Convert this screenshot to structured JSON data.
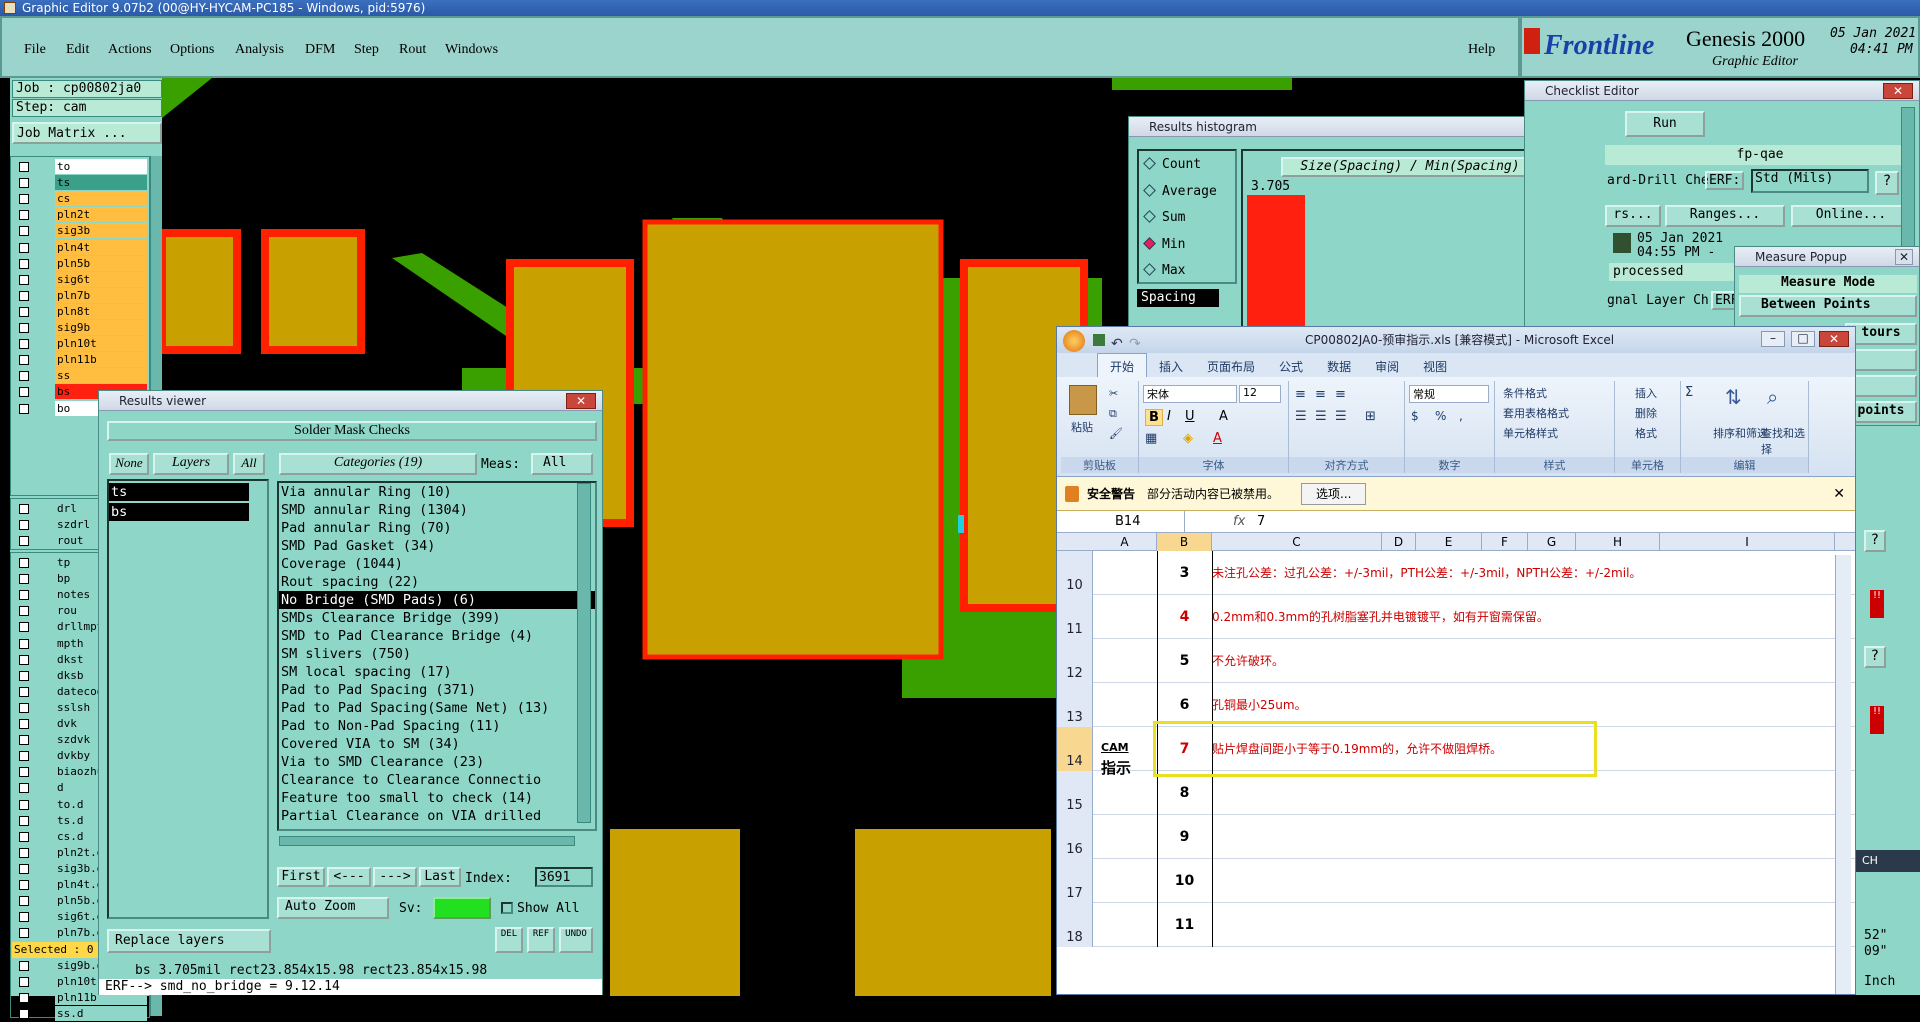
{
  "titlebar": {
    "text": "Graphic Editor 9.07b2 (00@HY-HYCAM-PC185 - Windows, pid:5976)"
  },
  "menu": {
    "items": [
      "File",
      "Edit",
      "Actions",
      "Options",
      "Analysis",
      "DFM",
      "Step",
      "Rout",
      "Windows"
    ],
    "help": "Help"
  },
  "brand": {
    "logo": "Frontline",
    "product": "Genesis 2000",
    "subtitle": "Graphic Editor",
    "date": "05 Jan 2021",
    "time": "04:41 PM"
  },
  "left": {
    "job": "Job : cp00802ja0",
    "step": "Step: cam",
    "job_matrix": "Job Matrix ...",
    "layers": [
      "to",
      "ts",
      "cs",
      "pln2t",
      "sig3b",
      "pln4t",
      "pln5b",
      "sig6t",
      "pln7b",
      "pln8t",
      "sig9b",
      "pln10t",
      "pln11b",
      "ss",
      "bs",
      "bo"
    ],
    "layers2": [
      "drl",
      "szdrl",
      "rout"
    ],
    "layers3": [
      "tp",
      "bp",
      "notes",
      "rou",
      "drllmpt",
      "mpth",
      "dkst",
      "dksb",
      "datecode",
      "sslsh",
      "dvk",
      "szdvk",
      "dvkby",
      "biaozhu",
      "d",
      "to.d",
      "ts.d",
      "cs.d",
      "pln2t.d",
      "sig3b.d",
      "pln4t.d",
      "pln5b.d",
      "sig6t.d",
      "pln7b.d",
      "pln8t.d",
      "sig9b.d",
      "pln10t",
      "pln11b",
      "ss.d"
    ],
    "selected": "Selected : 0"
  },
  "results_viewer": {
    "title": "Results viewer",
    "header": "Solder Mask Checks",
    "none": "None",
    "layers": "Layers",
    "all": "All",
    "categories": "Categories (19)",
    "meas_label": "Meas:",
    "meas_value": "All",
    "layer_list": [
      "ts",
      "bs"
    ],
    "checks": [
      "Via annular Ring (10)",
      "SMD annular Ring (1304)",
      "Pad annular Ring (70)",
      "SMD Pad Gasket (34)",
      "Coverage (1044)",
      "Rout spacing (22)",
      "No Bridge (SMD Pads) (6)",
      "SMDs Clearance Bridge (399)",
      "SMD to Pad Clearance Bridge (4)",
      "SM slivers (750)",
      "SM local spacing (17)",
      "Pad to Pad Spacing (371)",
      "Pad to Pad Spacing(Same Net) (13)",
      "Pad to Non-Pad Spacing (11)",
      "Covered VIA to SM (34)",
      "Via to SMD Clearance (23)",
      "Clearance to Clearance Connectio",
      "Feature too small to check (14)",
      "Partial Clearance on VIA drilled"
    ],
    "selected_index": 6,
    "first": "First",
    "prev": "<---",
    "next": "--->",
    "last": "Last",
    "index_label": "Index:",
    "index_value": "3691",
    "auto_zoom": "Auto Zoom",
    "sv": "Sv:",
    "show_all": "Show All",
    "replace_layers": "Replace layers",
    "del": "DEL",
    "ref": "REF",
    "undo": "UNDO",
    "status1": "bs 3.705mil  rect23.854x15.98  rect23.854x15.98",
    "status2": "ERF--> smd_no_bridge = 9.12.14"
  },
  "histogram": {
    "title": "Results histogram",
    "options": [
      "Count",
      "Average",
      "Sum",
      "Min",
      "Max"
    ],
    "selected": "Min",
    "spacing": "Spacing",
    "heading": "Size(Spacing) / Min(Spacing)",
    "value": "3.705"
  },
  "checklist": {
    "title": "Checklist Editor",
    "run": "Run",
    "name": "fp-qae",
    "row1": "ard-Drill Che",
    "erf": "ERF:",
    "std": "Std (Mils)",
    "help": "?",
    "rs": "rs...",
    "ranges": "Ranges...",
    "online": "Online...",
    "date": "05 Jan 2021",
    "time": "04:55 PM -",
    "processed": "processed",
    "signal": "gnal Layer Ch",
    "erf2": "ERF"
  },
  "measure": {
    "title": "Measure Popup",
    "mode": "Measure Mode",
    "between": "Between Points",
    "tours": "tours",
    "s": "s",
    "g": "g",
    "points": "points"
  },
  "tray": {
    "lang": "CH",
    "coord1": "52\"",
    "coord2": "09\"",
    "unit": "Inch"
  },
  "excel": {
    "title": "CP00802JA0-预审指示.xls [兼容模式] - Microsoft Excel",
    "tabs": [
      "开始",
      "插入",
      "页面布局",
      "公式",
      "数据",
      "审阅",
      "视图"
    ],
    "font_name": "宋体",
    "font_size": "12",
    "number_format": "常规",
    "groups": [
      "剪贴板",
      "字体",
      "对齐方式",
      "数字",
      "样式",
      "单元格",
      "编辑"
    ],
    "paste": "粘贴",
    "cond_format": "条件格式",
    "table_format": "套用表格格式",
    "cell_style": "单元格样式",
    "insert": "插入",
    "delete": "删除",
    "format": "格式",
    "sort": "排序和筛选",
    "find": "查找和选择",
    "security_label": "安全警告",
    "security_msg": "部分活动内容已被禁用。",
    "options_btn": "选项...",
    "cell_ref": "B14",
    "fx": "fx",
    "formula": "7",
    "cols": [
      "A",
      "B",
      "C",
      "D",
      "E",
      "F",
      "G",
      "H",
      "I"
    ],
    "rows": [
      {
        "num": "10",
        "b": "3",
        "c": "未注孔公差：过孔公差：+/-3mil，PTH公差：+/-3mil，NPTH公差：+/-2mil。"
      },
      {
        "num": "11",
        "b": "4",
        "c": "0.2mm和0.3mm的孔树脂塞孔并电镀镀平，如有开窗需保留。"
      },
      {
        "num": "12",
        "b": "5",
        "c": "不允许破环。"
      },
      {
        "num": "13",
        "b": "6",
        "c": "孔铜最小25um。"
      },
      {
        "num": "14",
        "b": "7",
        "c": "贴片焊盘间距小于等于0.19mm的，允许不做阻焊桥。"
      },
      {
        "num": "15",
        "b": "8",
        "c": ""
      },
      {
        "num": "16",
        "b": "9",
        "c": ""
      },
      {
        "num": "17",
        "b": "10",
        "c": ""
      },
      {
        "num": "18",
        "b": "11",
        "c": ""
      }
    ],
    "a_label_top": "CAM",
    "a_label": "指示"
  },
  "colors": {
    "teal": "#8ed6c8",
    "copper": "#c8a000",
    "green": "#3aa000",
    "red": "#ff2000",
    "excel_red": "#cc0000"
  }
}
